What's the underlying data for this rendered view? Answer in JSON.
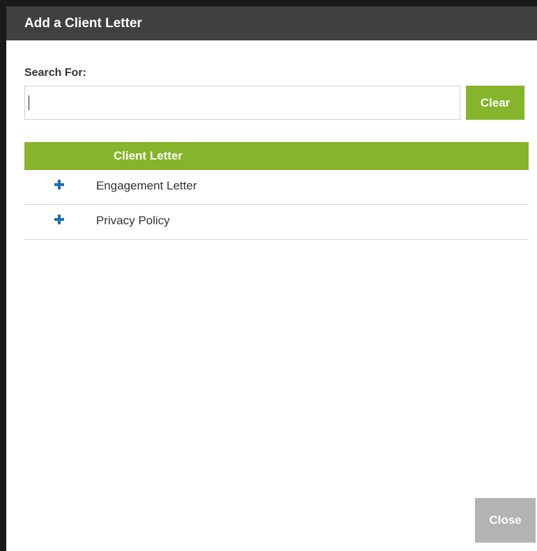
{
  "dialog": {
    "title": "Add a Client Letter"
  },
  "search": {
    "label": "Search For:",
    "value": "",
    "placeholder": "",
    "clear_label": "Clear"
  },
  "table": {
    "header": "Client Letter",
    "rows": [
      {
        "label": "Engagement Letter",
        "icon": "plus-icon"
      },
      {
        "label": "Privacy Policy",
        "icon": "plus-icon"
      }
    ]
  },
  "footer": {
    "close_label": "Close"
  },
  "colors": {
    "titlebar": "#404040",
    "accent_green": "#84b52a",
    "plus_blue": "#1f6fb2",
    "disabled_gray": "#b3b3b3"
  }
}
